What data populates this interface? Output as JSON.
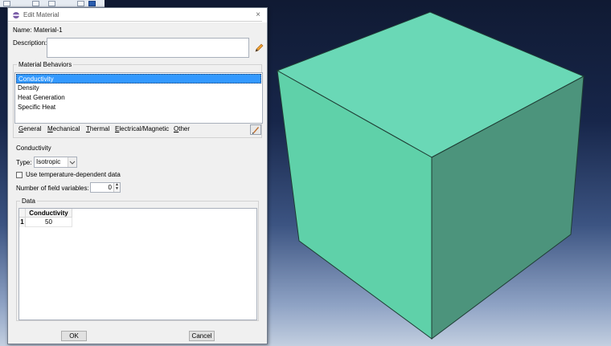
{
  "dialog": {
    "title": "Edit Material",
    "close_glyph": "×",
    "name_label": "Name:",
    "name_value": "Material-1",
    "description_label": "Description:",
    "description_value": ""
  },
  "material_behaviors": {
    "title": "Material Behaviors",
    "items": [
      {
        "label": "Conductivity",
        "selected": true
      },
      {
        "label": "Density",
        "selected": false
      },
      {
        "label": "Heat Generation",
        "selected": false
      },
      {
        "label": "Specific Heat",
        "selected": false
      }
    ]
  },
  "menu": {
    "general": {
      "mnemonic": "G",
      "rest": "eneral"
    },
    "mechanical": {
      "mnemonic": "M",
      "rest": "echanical"
    },
    "thermal": {
      "mnemonic": "T",
      "rest": "hermal"
    },
    "electrical": {
      "mnemonic": "E",
      "rest": "lectrical/Magnetic"
    },
    "other": {
      "mnemonic": "O",
      "rest": "ther"
    }
  },
  "conductivity": {
    "section_label": "Conductivity",
    "type_label": "Type:",
    "type_value": "Isotropic",
    "temp_dependent_label": "Use temperature-dependent data",
    "temp_dependent_checked": false,
    "field_vars_label": "Number of field variables:",
    "field_vars_value": "0"
  },
  "data": {
    "title": "Data",
    "column_header": "Conductivity",
    "rows": [
      {
        "num": "1",
        "value": "50"
      }
    ]
  },
  "buttons": {
    "ok": "OK",
    "cancel": "Cancel"
  },
  "colors": {
    "cube_top": "#6ad8b6",
    "cube_front": "#5fd1a9",
    "cube_right": "#4c947c",
    "selection": "#3399ff"
  }
}
